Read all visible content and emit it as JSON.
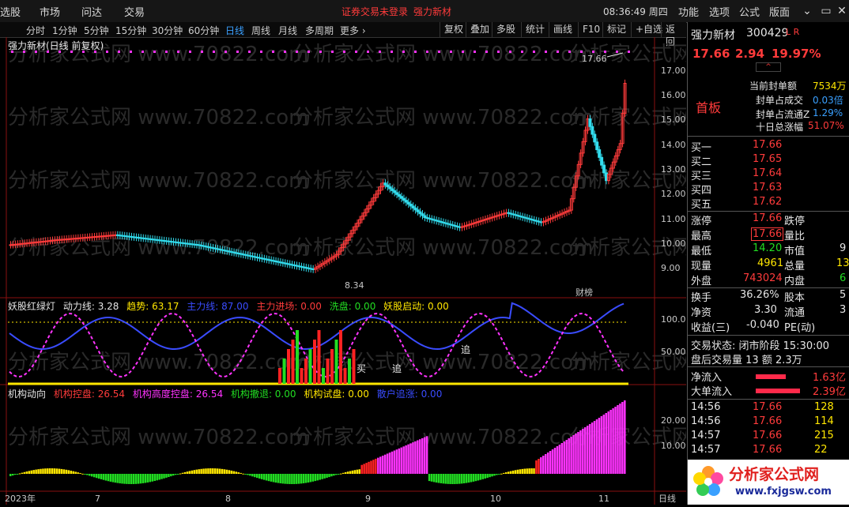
{
  "menubar": {
    "items": [
      "选股",
      "市场",
      "问达",
      "交易"
    ],
    "notice": "证券交易未登录",
    "stock_link": "强力新材",
    "clock": "08:36:49 周四",
    "right_items": [
      "功能",
      "选项",
      "公式",
      "版面"
    ]
  },
  "toolbar": {
    "timeframes": [
      "分时",
      "1分钟",
      "5分钟",
      "15分钟",
      "30分钟",
      "60分钟",
      "日线",
      "周线",
      "月线",
      "多周期",
      "更多 ›"
    ],
    "active": "日线",
    "buttons": [
      "复权",
      "叠加",
      "多股",
      "统计",
      "画线",
      "F10",
      "标记",
      "+自选",
      "返回"
    ]
  },
  "main_chart": {
    "title": "强力新材(日线 前复权)",
    "high_label": "17.66",
    "low_label": "8.34",
    "tag_label": "财榜",
    "watermark": "分析家公式网 www.70822.com",
    "y_ticks": [
      "17.00",
      "16.00",
      "15.00",
      "14.00",
      "13.00",
      "12.00",
      "11.00",
      "10.00",
      "9.00"
    ],
    "x_ticks": [
      "2023年",
      "7",
      "8",
      "9",
      "10",
      "11"
    ],
    "period_label": "日线"
  },
  "indicator1": {
    "name": "妖股红绿灯",
    "items": [
      {
        "label": "动力线: 3.28",
        "color": "#e6e6e6"
      },
      {
        "label": "趋势: 63.17",
        "color": "#ffe600"
      },
      {
        "label": "主力线: 87.00",
        "color": "#3a4cff"
      },
      {
        "label": "主力进场: 0.00",
        "color": "#ff3b3b"
      },
      {
        "label": "洗盘: 0.00",
        "color": "#22dd22"
      },
      {
        "label": "妖股启动: 0.00",
        "color": "#ffe600"
      }
    ],
    "y_ticks": [
      "100.0",
      "50.00"
    ],
    "tags": [
      "追",
      "追",
      "买"
    ]
  },
  "indicator2": {
    "name": "机构动向",
    "items": [
      {
        "label": "机构控盘: 26.54",
        "color": "#ff3b3b"
      },
      {
        "label": "机构高度控盘: 26.54",
        "color": "#ff33ff"
      },
      {
        "label": "机构撤退: 0.00",
        "color": "#22dd22"
      },
      {
        "label": "机构试盘: 0.00",
        "color": "#ffe600"
      },
      {
        "label": "散户追涨: 0.00",
        "color": "#3a4cff"
      }
    ],
    "y_ticks": [
      "20.00",
      "10.00"
    ]
  },
  "right_panel": {
    "name": "强力新材",
    "code": "300429",
    "flags": "L R",
    "price": "17.66",
    "change": "2.94",
    "pct": "19.97%",
    "board": "首板",
    "seal_stats": [
      {
        "label": "当前封单额",
        "value": "7534万"
      },
      {
        "label": "封单占成交",
        "value": "0.03倍"
      },
      {
        "label": "封单占流通Z",
        "value": "1.29%"
      },
      {
        "label": "十日总涨幅",
        "value": "51.07%"
      }
    ],
    "bids": [
      {
        "label": "买一",
        "price": "17.66"
      },
      {
        "label": "买二",
        "price": "17.65"
      },
      {
        "label": "买三",
        "price": "17.64"
      },
      {
        "label": "买四",
        "price": "17.63"
      },
      {
        "label": "买五",
        "price": "17.62"
      }
    ],
    "quote": [
      {
        "l1": "涨停",
        "v1": "17.66",
        "l2": "跌停",
        "v2": ""
      },
      {
        "l1": "最高",
        "v1": "17.66",
        "l2": "量比",
        "v2": ""
      },
      {
        "l1": "最低",
        "v1": "14.20",
        "l2": "市值",
        "v2": "9"
      },
      {
        "l1": "现量",
        "v1": "4961",
        "l2": "总量",
        "v2": "13"
      },
      {
        "l1": "外盘",
        "v1": "743024",
        "l2": "内盘",
        "v2": "6"
      }
    ],
    "stats": [
      {
        "l1": "换手",
        "v1": "36.26%",
        "l2": "股本",
        "v2": "5"
      },
      {
        "l1": "净资",
        "v1": "3.30",
        "l2": "流通",
        "v2": "3"
      },
      {
        "l1": "收益(三)",
        "v1": "-0.040",
        "l2": "PE(动)",
        "v2": ""
      }
    ],
    "trade_state": "交易状态: 闭市阶段 15:30:00",
    "after_hours": "盘后交易量 13 额 2.3万",
    "net_inflow": {
      "label": "净流入",
      "value": "1.63亿"
    },
    "big_inflow": {
      "label": "大单流入",
      "value": "2.39亿"
    },
    "ticks": [
      {
        "time": "14:56",
        "price": "17.66",
        "vol": "128"
      },
      {
        "time": "14:56",
        "price": "17.66",
        "vol": "114"
      },
      {
        "time": "14:57",
        "price": "17.66",
        "vol": "215"
      },
      {
        "time": "14:57",
        "price": "17.66",
        "vol": "22"
      }
    ],
    "ad_text": "分析家公式网",
    "ad_url": "www.fxjgsw.com"
  },
  "colors": {
    "up": "#ff3b3b",
    "down": "#33ddee",
    "bg": "#000000"
  }
}
